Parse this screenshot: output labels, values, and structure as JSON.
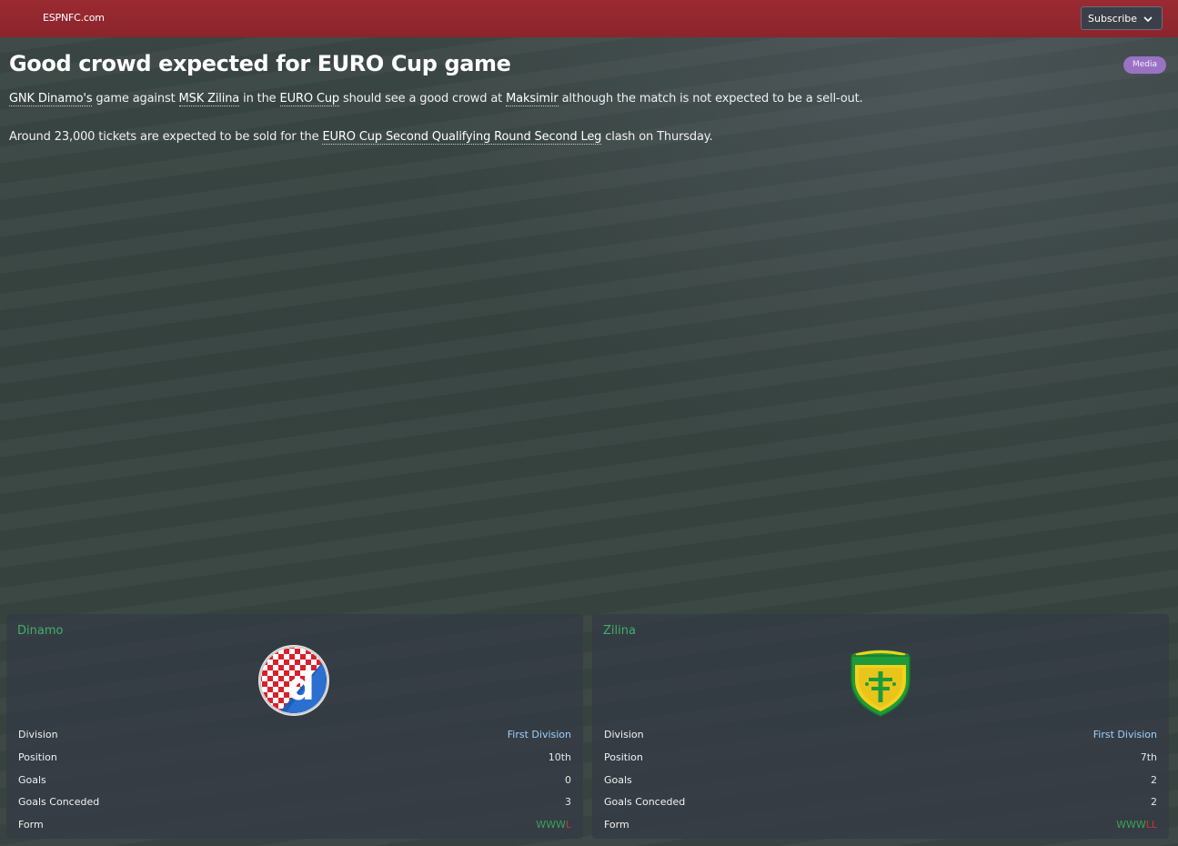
{
  "header": {
    "source": "ESPNFC.com",
    "subscribe_label": "Subscribe"
  },
  "article": {
    "title": "Good crowd expected for EURO Cup game",
    "badge": "Media",
    "p1": {
      "link1": "GNK Dinamo's",
      "t1": " game against ",
      "link2": "MSK Zilina",
      "t2": " in the ",
      "link3": "EURO Cup",
      "t3": " should see a good crowd at ",
      "link4": "Maksimir",
      "t4": " although the match is not expected to be a sell-out."
    },
    "p2": {
      "t1": "Around 23,000 tickets are expected to be sold for the ",
      "link1": "EURO Cup Second Qualifying Round Second Leg",
      "t2": " clash on Thursday."
    }
  },
  "teams": [
    {
      "name": "Dinamo",
      "crest_icon": "dinamo-crest-icon",
      "stats": {
        "division_label": "Division",
        "division": "First Division",
        "position_label": "Position",
        "position": "10th",
        "goals_label": "Goals",
        "goals": "0",
        "conceded_label": "Goals Conceded",
        "conceded": "3",
        "form_label": "Form",
        "form_w": "WWW",
        "form_l": "L"
      }
    },
    {
      "name": "Zilina",
      "crest_icon": "zilina-crest-icon",
      "stats": {
        "division_label": "Division",
        "division": "First Division",
        "position_label": "Position",
        "position": "7th",
        "goals_label": "Goals",
        "goals": "2",
        "conceded_label": "Goals Conceded",
        "conceded": "2",
        "form_label": "Form",
        "form_w": "WWW",
        "form_l": "LL"
      }
    }
  ],
  "colors": {
    "header_red": "#8c242c",
    "team_green": "#3fb06a",
    "badge_purple": "#9a72c4",
    "form_win": "#3aa35d",
    "form_loss": "#c0392b"
  }
}
